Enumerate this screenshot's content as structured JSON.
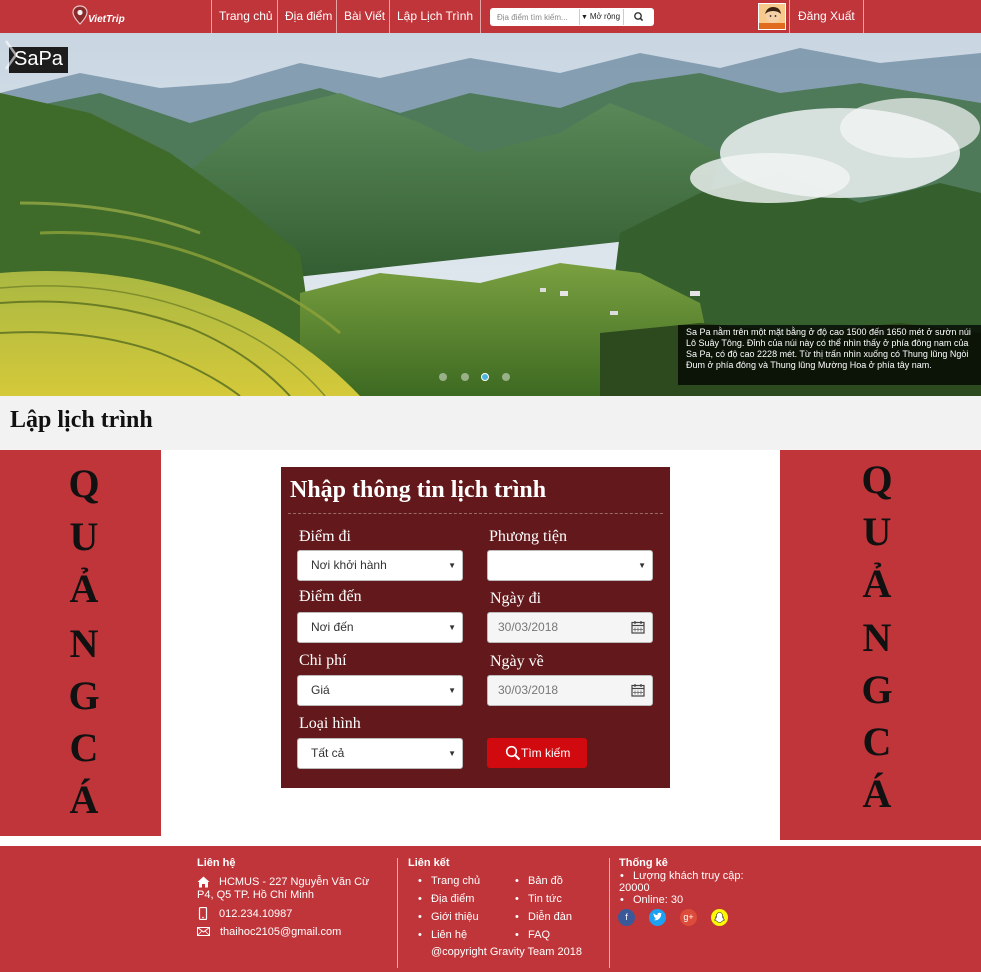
{
  "header": {
    "logo_text": "VietTrip",
    "nav": [
      "Trang chủ",
      "Địa điểm",
      "Bài Viết",
      "Lập Lịch Trình"
    ],
    "search_placeholder": "Địa điểm tìm kiếm...",
    "advanced_label": "Mở rộng",
    "logout_label": "Đăng Xuất"
  },
  "banner": {
    "title": "SaPa",
    "caption": "Sa Pa nằm trên một mặt bằng ở độ cao 1500 đến 1650 mét ở sườn núi Lô Suây Tông. Đỉnh của núi này có thể nhìn thấy ở phía đông nam của Sa Pa, có độ cao 2228 mét. Từ thị trấn nhìn xuống có Thung lũng Ngòi Đum ở phía đông và Thung lũng Mường Hoa ở phía tây nam.",
    "slide_count": 4,
    "active_slide": 3
  },
  "page_title": "Lập lịch trình",
  "ad_letters": [
    "Q",
    "U",
    "Ả",
    "N",
    "G",
    "C",
    "Á"
  ],
  "form": {
    "title": "Nhập thông tin lịch trình",
    "from_label": "Điểm đi",
    "from_value": "Nơi khởi hành",
    "to_label": "Điểm đến",
    "to_value": "Nơi đến",
    "cost_label": "Chi phí",
    "cost_value": "Giá",
    "type_label": "Loại hình",
    "type_value": "Tất cả",
    "vehicle_label": "Phương tiện",
    "vehicle_value": "",
    "depart_label": "Ngày đi",
    "depart_value": "30/03/2018",
    "return_label": "Ngày về",
    "return_value": "30/03/2018",
    "search_button": "Tìm kiếm"
  },
  "footer": {
    "contact_heading": "Liên hệ",
    "address_line1": "HCMUS - 227 Nguyễn Văn Cừ",
    "address_line2": "P4, Q5 TP. Hồ Chí Minh",
    "phone": "012.234.10987",
    "email": "thaihoc2105@gmail.com",
    "links_heading": "Liên kết",
    "links_col1": [
      "Trang chủ",
      "Địa điểm",
      "Giới thiệu",
      "Liên hệ"
    ],
    "links_col2": [
      "Bản đồ",
      "Tin tức",
      "Diễn đàn",
      "FAQ"
    ],
    "copyright": "@copyright Gravity Team 2018",
    "stats_heading": "Thống kê",
    "visits_label": "Lượng khách truy cập:",
    "visits_value": "20000",
    "online_text": "Online: 30",
    "social_colors": {
      "facebook": "#3b5998",
      "twitter": "#1da1f2",
      "google": "#dd4b39",
      "snapchat": "#fffc00"
    }
  }
}
